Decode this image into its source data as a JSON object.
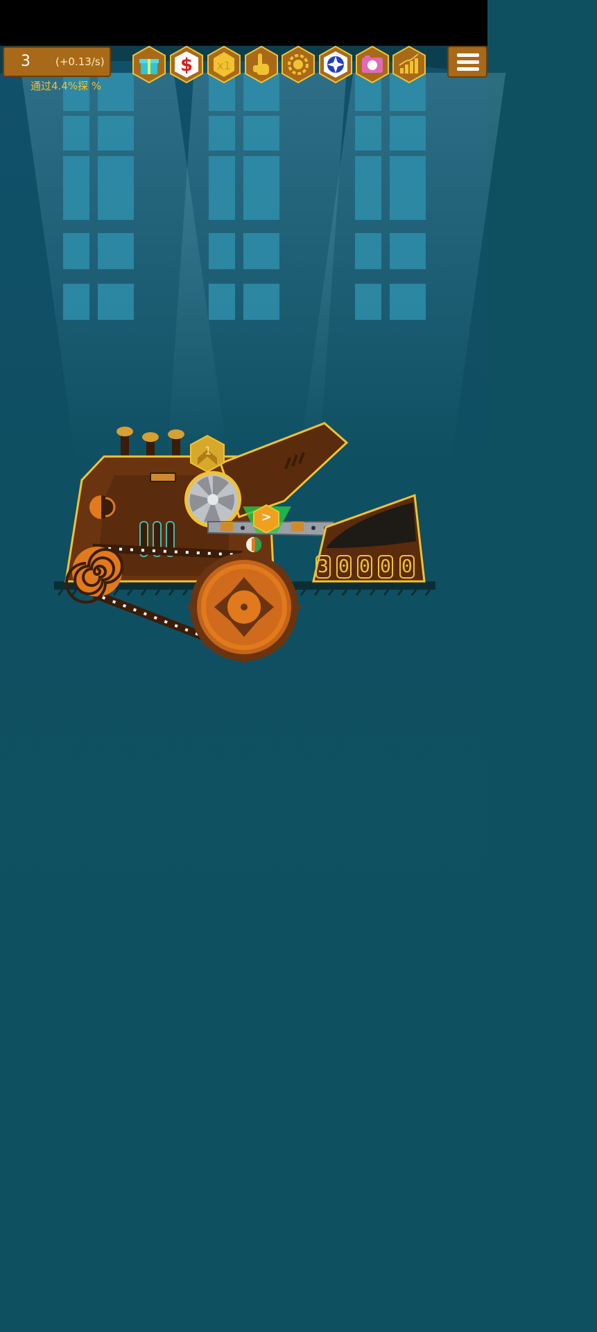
{
  "hud": {
    "coins": "3",
    "rate": "(+0.13/s)",
    "progress": "通过4.4%探  %"
  },
  "toolbar": {
    "buttons": [
      {
        "icon": "gift-icon"
      },
      {
        "icon": "dollar-icon"
      },
      {
        "icon": "multiplier-icon",
        "label": "x1"
      },
      {
        "icon": "tap-hand-icon"
      },
      {
        "icon": "gear-upgrade-icon"
      },
      {
        "icon": "portal-icon"
      },
      {
        "icon": "camera-icon"
      },
      {
        "icon": "stats-chart-icon"
      }
    ],
    "menu_icon": "hamburger-menu-icon"
  },
  "machine": {
    "saw_level": "1",
    "output_counter": [
      "3",
      "0",
      "0",
      "0",
      "0"
    ],
    "conveyor_arrow": ">"
  },
  "colors": {
    "background": "#0f5060",
    "machine_body": "#6b3410",
    "trim": "#f1c232",
    "accent_orange": "#e07a1c"
  }
}
